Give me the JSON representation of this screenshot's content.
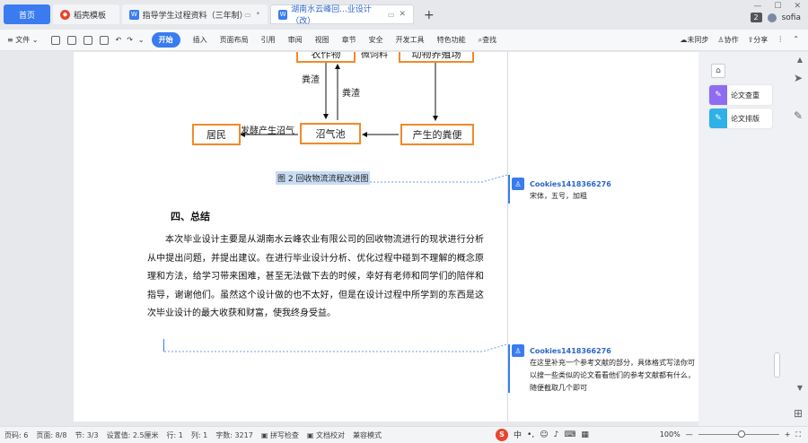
{
  "tabs": [
    {
      "label": "首页"
    },
    {
      "label": "稻壳模板"
    },
    {
      "label": "指导学生过程资料（三年制）"
    },
    {
      "label": "湖南水云峰回...业设计（改）"
    }
  ],
  "window": {
    "count": "2",
    "user": "sofia"
  },
  "menu": {
    "file": "文件",
    "start": "开始",
    "items": [
      "插入",
      "页面布局",
      "引用",
      "审阅",
      "视图",
      "章节",
      "安全",
      "开发工具",
      "特色功能"
    ],
    "search": "查找",
    "sync": "未同步",
    "collab": "协作",
    "share": "分享"
  },
  "diagram": {
    "top_left": "农作物",
    "top_mid": "微饲料",
    "top_right": "动物养殖场",
    "arrow_down_label": "粪渣",
    "arrow_up_label": "粪渣",
    "residents": "居民",
    "biogas": "沼气池",
    "manure": "产生的粪便",
    "ferment": "发酵产生沼气"
  },
  "document": {
    "caption": "图 2 回收物流流程改进图",
    "section_title": "四、总结",
    "paragraph": "本次毕业设计主要是从湖南水云峰农业有限公司的回收物流进行的现状进行分析从中提出问题，并提出建议。在进行毕业设计分析、优化过程中碰到不理解的概念原理和方法，给学习带来困难，甚至无法做下去的时候，幸好有老师和同学们的陪伴和指导，谢谢他们。虽然这个设计做的也不太好，但是在设计过程中所学到的东西是这次毕业设计的最大收获和财富，使我终身受益。"
  },
  "comments": [
    {
      "author": "Cookies1418366276",
      "text": "宋体，五号，加粗"
    },
    {
      "author": "Cookies1418366276",
      "text": "在这里补充一个参考文献的部分，具体格式写法你可以搜一些类似的论文看看他们的参考文献都有什么，随便截取几个即可"
    }
  ],
  "side_panel": {
    "btn1": "论文查重",
    "btn2": "论文排版"
  },
  "status": {
    "page_code": "页码: 6",
    "pages": "页面: 8/8",
    "section": "节: 3/3",
    "setting": "设置值: 2.5厘米",
    "row": "行: 1",
    "col": "列: 1",
    "words": "字数: 3217",
    "spell": "拼写检查",
    "proof": "文档校对",
    "compat": "兼容模式",
    "zoom": "100%"
  }
}
